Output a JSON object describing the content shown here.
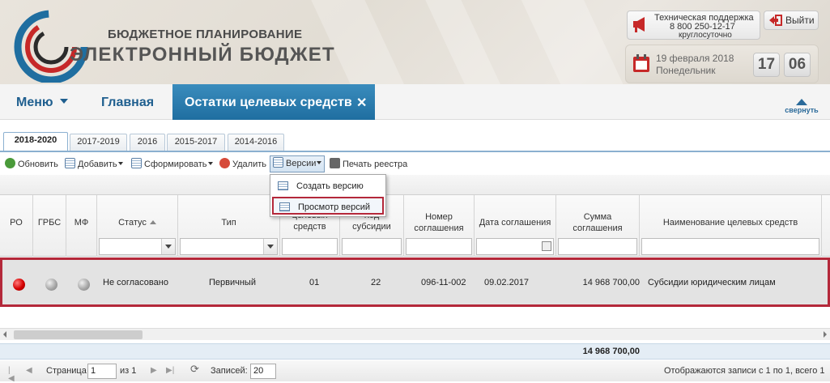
{
  "header": {
    "brand_top": "БЮДЖЕТНОЕ ПЛАНИРОВАНИЕ",
    "brand_main": "ЭЛЕКТРОННЫЙ БЮДЖЕТ",
    "support_line1": "Техническая поддержка",
    "support_phone": "8 800 250-12-17",
    "support_hours": "круглосуточно",
    "logout_label": "Выйти",
    "date": "19 февраля 2018",
    "weekday": "Понедельник",
    "clock_hours": "17",
    "clock_minutes": "06"
  },
  "nav": {
    "menu_label": "Меню",
    "home_label": "Главная",
    "active_tab_label": "Остатки целевых средств",
    "close_symbol": "✕",
    "collapse_label": "свернуть"
  },
  "year_tabs": [
    {
      "label": "2018-2020",
      "active": true
    },
    {
      "label": "2017-2019",
      "active": false
    },
    {
      "label": "2016",
      "active": false
    },
    {
      "label": "2015-2017",
      "active": false
    },
    {
      "label": "2014-2016",
      "active": false
    }
  ],
  "toolbar": {
    "refresh": "Обновить",
    "add": "Добавить",
    "form": "Сформировать",
    "delete": "Удалить",
    "versions": "Версии",
    "print": "Печать реестра"
  },
  "versions_menu": {
    "create": "Создать версию",
    "view": "Просмотр версий"
  },
  "grid": {
    "columns": {
      "ro": "РО",
      "grbs": "ГРБС",
      "mf": "МФ",
      "status": "Статус",
      "type": "Тип",
      "target_funds_line2": "целевых",
      "target_funds_line3": "средств",
      "subsidy_line1": "Код",
      "subsidy_line2": "субсидии",
      "agreement_no_line1": "Номер",
      "agreement_no_line2": "соглашения",
      "agreement_date": "Дата соглашения",
      "agreement_sum_line1": "Сумма",
      "agreement_sum_line2": "соглашения",
      "funds_name": "Наименование целевых средств"
    },
    "row": {
      "status": "Не согласовано",
      "type": "Первичный",
      "target_code": "01",
      "subsidy_code": "22",
      "agreement_no": "096-11-002",
      "agreement_date": "09.02.2017",
      "sum": "14 968 700,00",
      "funds_name": "Субсидии юридическим лицам"
    },
    "summary_total": "14 968 700,00"
  },
  "pager": {
    "page_label": "Страница",
    "page_value": "1",
    "of_label": "из 1",
    "records_label": "Записей:",
    "records_value": "20",
    "info": "Отображаются записи с 1 по 1, всего 1"
  },
  "colors": {
    "accent_blue": "#1f6ea0",
    "highlight_red": "#b4283a"
  }
}
